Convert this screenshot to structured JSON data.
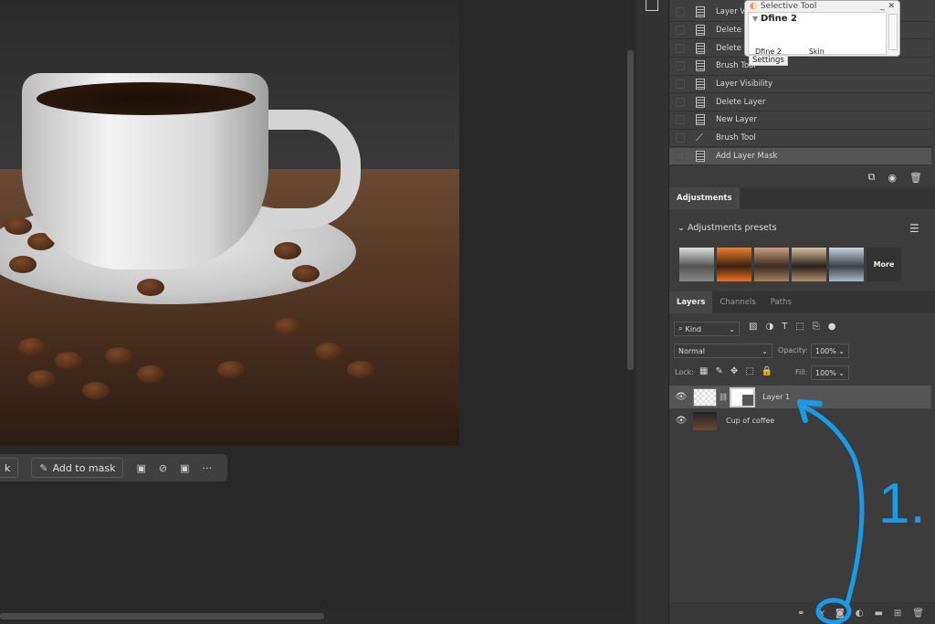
{
  "canvas": {
    "context_bar": {
      "partial_label": "k",
      "add_to_mask": "Add to mask",
      "more": "···"
    }
  },
  "history": {
    "items": [
      {
        "label": "Layer Visibility",
        "icon": "document-icon",
        "partial": "Layer Vi"
      },
      {
        "label": "Delete Layer",
        "icon": "document-icon",
        "partial": "Delete La"
      },
      {
        "label": "Delete Layer",
        "icon": "document-icon",
        "partial": "Delete La"
      },
      {
        "label": "Brush Tool",
        "icon": "document-icon"
      },
      {
        "label": "Layer Visibility",
        "icon": "document-icon"
      },
      {
        "label": "Delete Layer",
        "icon": "document-icon"
      },
      {
        "label": "New Layer",
        "icon": "document-icon"
      },
      {
        "label": "Brush Tool",
        "icon": "brush-icon"
      },
      {
        "label": "Add Layer Mask",
        "icon": "document-icon",
        "selected": true
      }
    ]
  },
  "dialog": {
    "title": "Selective Tool",
    "heading": "Dfine 2",
    "col1": "Dfine 2",
    "col2": "Skin",
    "settings": "Settings"
  },
  "adjustments": {
    "tab": "Adjustments",
    "section": "Adjustments presets",
    "more": "More"
  },
  "layers": {
    "tabs": [
      "Layers",
      "Channels",
      "Paths"
    ],
    "filter": "Kind",
    "blend_mode": "Normal",
    "opacity_label": "Opacity:",
    "opacity": "100%",
    "lock_label": "Lock:",
    "fill_label": "Fill:",
    "fill": "100%",
    "items": [
      {
        "name": "Layer 1",
        "selected": true
      },
      {
        "name": "Cup of coffee"
      }
    ]
  },
  "annotation": {
    "text": "1.",
    "color": "#1a9be8"
  }
}
